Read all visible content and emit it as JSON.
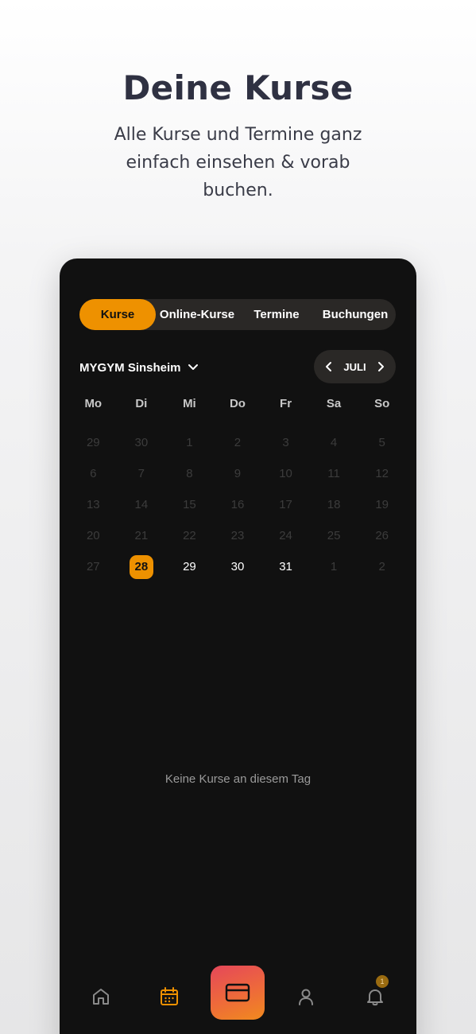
{
  "hero": {
    "title": "Deine Kurse",
    "subtitle": "Alle Kurse und Termine ganz einfach einsehen & vorab buchen."
  },
  "tabs": [
    {
      "label": "Kurse",
      "active": true
    },
    {
      "label": "Online-Kurse",
      "active": false
    },
    {
      "label": "Termine",
      "active": false
    },
    {
      "label": "Buchungen",
      "active": false
    }
  ],
  "location": {
    "name": "MYGYM Sinsheim",
    "icon": "chevron-down-icon"
  },
  "month_nav": {
    "label": "JULI",
    "prev_icon": "chevron-left-icon",
    "next_icon": "chevron-right-icon"
  },
  "weekdays": [
    "Mo",
    "Di",
    "Mi",
    "Do",
    "Fr",
    "Sa",
    "So"
  ],
  "calendar": {
    "weeks": [
      [
        {
          "d": "29"
        },
        {
          "d": "30"
        },
        {
          "d": "1"
        },
        {
          "d": "2"
        },
        {
          "d": "3"
        },
        {
          "d": "4"
        },
        {
          "d": "5"
        }
      ],
      [
        {
          "d": "6"
        },
        {
          "d": "7"
        },
        {
          "d": "8"
        },
        {
          "d": "9"
        },
        {
          "d": "10"
        },
        {
          "d": "11"
        },
        {
          "d": "12"
        }
      ],
      [
        {
          "d": "13"
        },
        {
          "d": "14"
        },
        {
          "d": "15"
        },
        {
          "d": "16"
        },
        {
          "d": "17"
        },
        {
          "d": "18"
        },
        {
          "d": "19"
        }
      ],
      [
        {
          "d": "20"
        },
        {
          "d": "21"
        },
        {
          "d": "22"
        },
        {
          "d": "23"
        },
        {
          "d": "24"
        },
        {
          "d": "25"
        },
        {
          "d": "26"
        }
      ],
      [
        {
          "d": "27"
        },
        {
          "d": "28",
          "selected": true
        },
        {
          "d": "29",
          "active": true
        },
        {
          "d": "30",
          "active": true
        },
        {
          "d": "31",
          "active": true
        },
        {
          "d": "1"
        },
        {
          "d": "2"
        }
      ]
    ]
  },
  "empty_message": "Keine Kurse an diesem Tag",
  "bottom_nav": {
    "items": [
      "home-icon",
      "calendar-icon",
      "card-icon",
      "profile-icon",
      "bell-icon"
    ],
    "active": "calendar-icon",
    "notification_count": "1"
  },
  "colors": {
    "accent": "#ee9100",
    "background": "#111111",
    "surface": "#2a2826",
    "card_gradient_start": "#e5475a",
    "card_gradient_end": "#f08a1e"
  }
}
